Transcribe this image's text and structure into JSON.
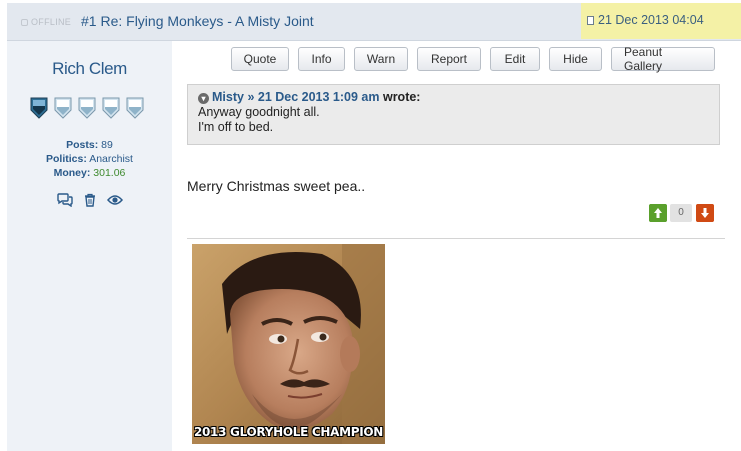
{
  "post": {
    "status": "OFFLINE",
    "title": "#1 Re: Flying Monkeys - A Misty Joint",
    "date": "21 Dec 2013 04:04"
  },
  "author": {
    "name": "Rich Clem",
    "rank_icon": "shield-icon",
    "rank_filled": 1,
    "rank_total": 5,
    "stats": [
      {
        "label": "Posts:",
        "value": "89"
      },
      {
        "label": "Politics:",
        "value": "Anarchist"
      },
      {
        "label": "Money:",
        "value": "301.06"
      }
    ],
    "action_icons": [
      "message-icon",
      "trash-icon",
      "eye-icon"
    ]
  },
  "actions": [
    "Quote",
    "Info",
    "Warn",
    "Report",
    "Edit",
    "Hide",
    "Peanut Gallery"
  ],
  "quote": {
    "author": "Misty",
    "date": "» 21 Dec 2013 1:09 am",
    "wrote": "wrote:",
    "lines": [
      "Anyway goodnight all.",
      "I'm off to bed."
    ]
  },
  "body": "Merry Christmas sweet pea..",
  "votes": {
    "count": "0"
  },
  "image": {
    "caption": "2013 GLORYHOLE CHAMPION"
  },
  "colors": {
    "accent": "#2a5a8a",
    "highlight": "#f4f1a6",
    "vote_up": "#5aa02c",
    "vote_down": "#d04a14"
  }
}
